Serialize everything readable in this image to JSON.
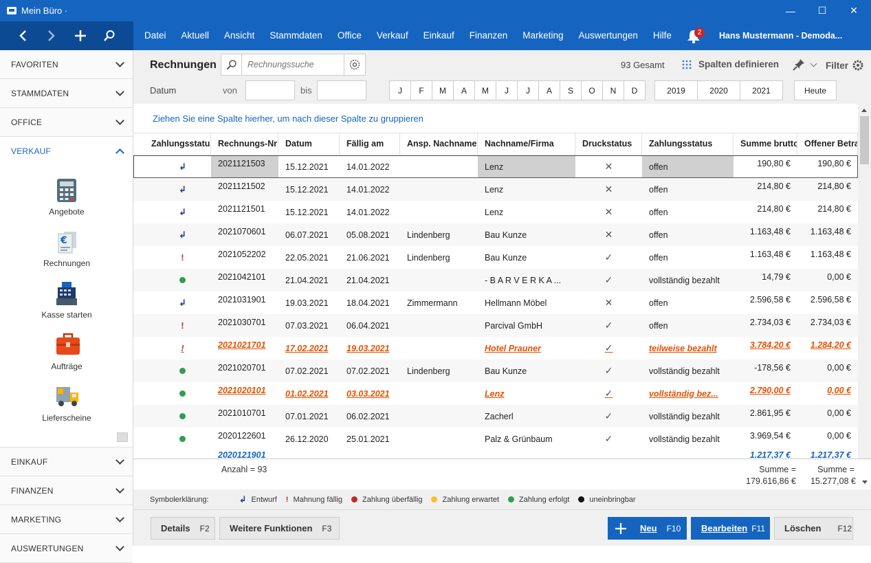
{
  "window": {
    "title": "Mein Büro ·",
    "minimize": "—",
    "maximize": "☐",
    "close": "✕"
  },
  "menu": [
    "Datei",
    "Aktuell",
    "Ansicht",
    "Stammdaten",
    "Office",
    "Verkauf",
    "Einkauf",
    "Finanzen",
    "Marketing",
    "Auswertungen",
    "Hilfe"
  ],
  "notifications": {
    "count": "2"
  },
  "user": {
    "name": "Hans Mustermann - Demoda..."
  },
  "sidebar": {
    "top_sections": [
      "FAVORITEN",
      "STAMMDATEN",
      "OFFICE"
    ],
    "open_section": "VERKAUF",
    "items": [
      {
        "label": "Angebote",
        "icon": "calculator-icon"
      },
      {
        "label": "Rechnungen",
        "icon": "invoice-euro-icon"
      },
      {
        "label": "Kasse starten",
        "icon": "cash-register-icon"
      },
      {
        "label": "Aufträge",
        "icon": "briefcase-icon"
      },
      {
        "label": "Lieferscheine",
        "icon": "delivery-truck-icon"
      }
    ],
    "bottom_sections": [
      "EINKAUF",
      "FINANZEN",
      "MARKETING",
      "AUSWERTUNGEN"
    ]
  },
  "toolbar": {
    "title": "Rechnungen",
    "search_placeholder": "Rechnungssuche",
    "total": "93 Gesamt",
    "columns_button": "Spalten definieren",
    "filter": "Filter",
    "date_label": "Datum",
    "from_label": "von",
    "to_label": "bis",
    "months": [
      "J",
      "F",
      "M",
      "A",
      "M",
      "J",
      "J",
      "A",
      "S",
      "O",
      "N",
      "D"
    ],
    "years": [
      "2019",
      "2020",
      "2021"
    ],
    "today": "Heute"
  },
  "grid": {
    "group_hint": "Ziehen Sie eine Spalte hierher, um nach dieser Spalte zu gruppieren",
    "columns": [
      "Zahlungsstatus",
      "Rechnungs-Nr",
      "Datum",
      "Fällig am",
      "Ansp. Nachname",
      "Nachname/Firma",
      "Druckstatus",
      "Zahlungsstatus",
      "Summe brutto",
      "Offener Betrag"
    ],
    "rows": [
      {
        "sym": "draft",
        "nr": "2021121503",
        "datum": "15.12.2021",
        "faellig": "14.01.2022",
        "ansp": "",
        "firma": "Lenz",
        "druck": "x",
        "status": "offen",
        "summe": "190,80 €",
        "offen": "190,80 €",
        "sel": true
      },
      {
        "sym": "draft",
        "nr": "2021121502",
        "datum": "15.12.2021",
        "faellig": "14.01.2022",
        "ansp": "",
        "firma": "Lenz",
        "druck": "x",
        "status": "offen",
        "summe": "214,80 €",
        "offen": "214,80 €"
      },
      {
        "sym": "draft",
        "nr": "2021121501",
        "datum": "15.12.2021",
        "faellig": "14.01.2022",
        "ansp": "",
        "firma": "Lenz",
        "druck": "x",
        "status": "offen",
        "summe": "214,80 €",
        "offen": "214,80 €"
      },
      {
        "sym": "draft",
        "nr": "2021070601",
        "datum": "06.07.2021",
        "faellig": "05.08.2021",
        "ansp": "Lindenberg",
        "firma": "Bau Kunze",
        "druck": "x",
        "status": "offen",
        "summe": "1.163,48 €",
        "offen": "1.163,48 €"
      },
      {
        "sym": "dun",
        "nr": "2021052202",
        "datum": "22.05.2021",
        "faellig": "21.06.2021",
        "ansp": "Lindenberg",
        "firma": "Bau Kunze",
        "druck": "ok",
        "status": "offen",
        "summe": "1.163,48 €",
        "offen": "1.163,48 €"
      },
      {
        "sym": "paid",
        "nr": "2021042101",
        "datum": "21.04.2021",
        "faellig": "21.04.2021",
        "ansp": "",
        "firma": "- B A R V E R K A ...",
        "druck": "ok",
        "status": "vollständig bezahlt",
        "summe": "14,79 €",
        "offen": "0,00 €"
      },
      {
        "sym": "draft",
        "nr": "2021031901",
        "datum": "19.03.2021",
        "faellig": "18.04.2021",
        "ansp": "Zimmermann",
        "firma": "Hellmann Möbel",
        "druck": "x",
        "status": "offen",
        "summe": "2.596,58 €",
        "offen": "2.596,58 €"
      },
      {
        "sym": "dun",
        "nr": "2021030701",
        "datum": "07.03.2021",
        "faellig": "06.04.2021",
        "ansp": "",
        "firma": "Parcival GmbH",
        "druck": "ok",
        "status": "offen",
        "summe": "2.734,03 €",
        "offen": "2.734,03 €"
      },
      {
        "sym": "dun",
        "nr": "2021021701",
        "datum": "17.02.2021",
        "faellig": "19.03.2021",
        "ansp": "",
        "firma": "Hotel Prauner",
        "druck": "ok",
        "status": "teilweise bezahlt",
        "summe": "3.784,20 €",
        "offen": "1.284,20 €",
        "hl": true
      },
      {
        "sym": "paid",
        "nr": "2021020701",
        "datum": "07.02.2021",
        "faellig": "07.02.2021",
        "ansp": "Lindenberg",
        "firma": "Bau Kunze",
        "druck": "ok",
        "status": "vollständig bezahlt",
        "summe": "-178,56 €",
        "offen": "0,00 €"
      },
      {
        "sym": "paid",
        "nr": "2021020101",
        "datum": "01.02.2021",
        "faellig": "03.03.2021",
        "ansp": "",
        "firma": "Lenz",
        "druck": "ok",
        "status": "vollständig bez...",
        "summe": "2.790,00 €",
        "offen": "0,00 €",
        "hl": true
      },
      {
        "sym": "paid",
        "nr": "2021010701",
        "datum": "07.01.2021",
        "faellig": "06.02.2021",
        "ansp": "",
        "firma": "Zacherl",
        "druck": "ok",
        "status": "vollständig bezahlt",
        "summe": "2.861,95 €",
        "offen": "0,00 €"
      },
      {
        "sym": "paid",
        "nr": "2020122601",
        "datum": "26.12.2020",
        "faellig": "25.01.2021",
        "ansp": "",
        "firma": "Palz & Grünbaum",
        "druck": "ok",
        "status": "vollständig bezahlt",
        "summe": "3.969,54 €",
        "offen": "0,00 €"
      }
    ],
    "partial_row": {
      "nr": "2020121901",
      "summe": "1.217,37 €",
      "offen": "1.217,37 €"
    }
  },
  "footer": {
    "count": "Anzahl = 93",
    "sum_label": "Summe =",
    "sum_brutto": "179.616,86 €",
    "sum_offen": "15.277,08 €"
  },
  "legend": {
    "label": "Symbolerklärung:",
    "items": [
      {
        "text": "Entwurf",
        "kind": "draft"
      },
      {
        "text": "Mahnung fällig",
        "kind": "dun"
      },
      {
        "text": "Zahlung überfällig",
        "color": "#c62828"
      },
      {
        "text": "Zahlung erwartet",
        "color": "#fbc02d"
      },
      {
        "text": "Zahlung erfolgt",
        "color": "#2e9e4f"
      },
      {
        "text": "uneinbringbar",
        "color": "#111111"
      }
    ]
  },
  "buttons": {
    "details": "Details",
    "details_key": "F2",
    "more": "Weitere Funktionen",
    "more_key": "F3",
    "new": "Neu",
    "new_key": "F10",
    "edit": "Bearbeiten",
    "edit_key": "F11",
    "delete": "Löschen",
    "delete_key": "F12"
  },
  "colors": {
    "accent": "#1565c0",
    "highlight": "#e65100",
    "paid": "#2e9e4f",
    "dunning": "#c62828"
  }
}
